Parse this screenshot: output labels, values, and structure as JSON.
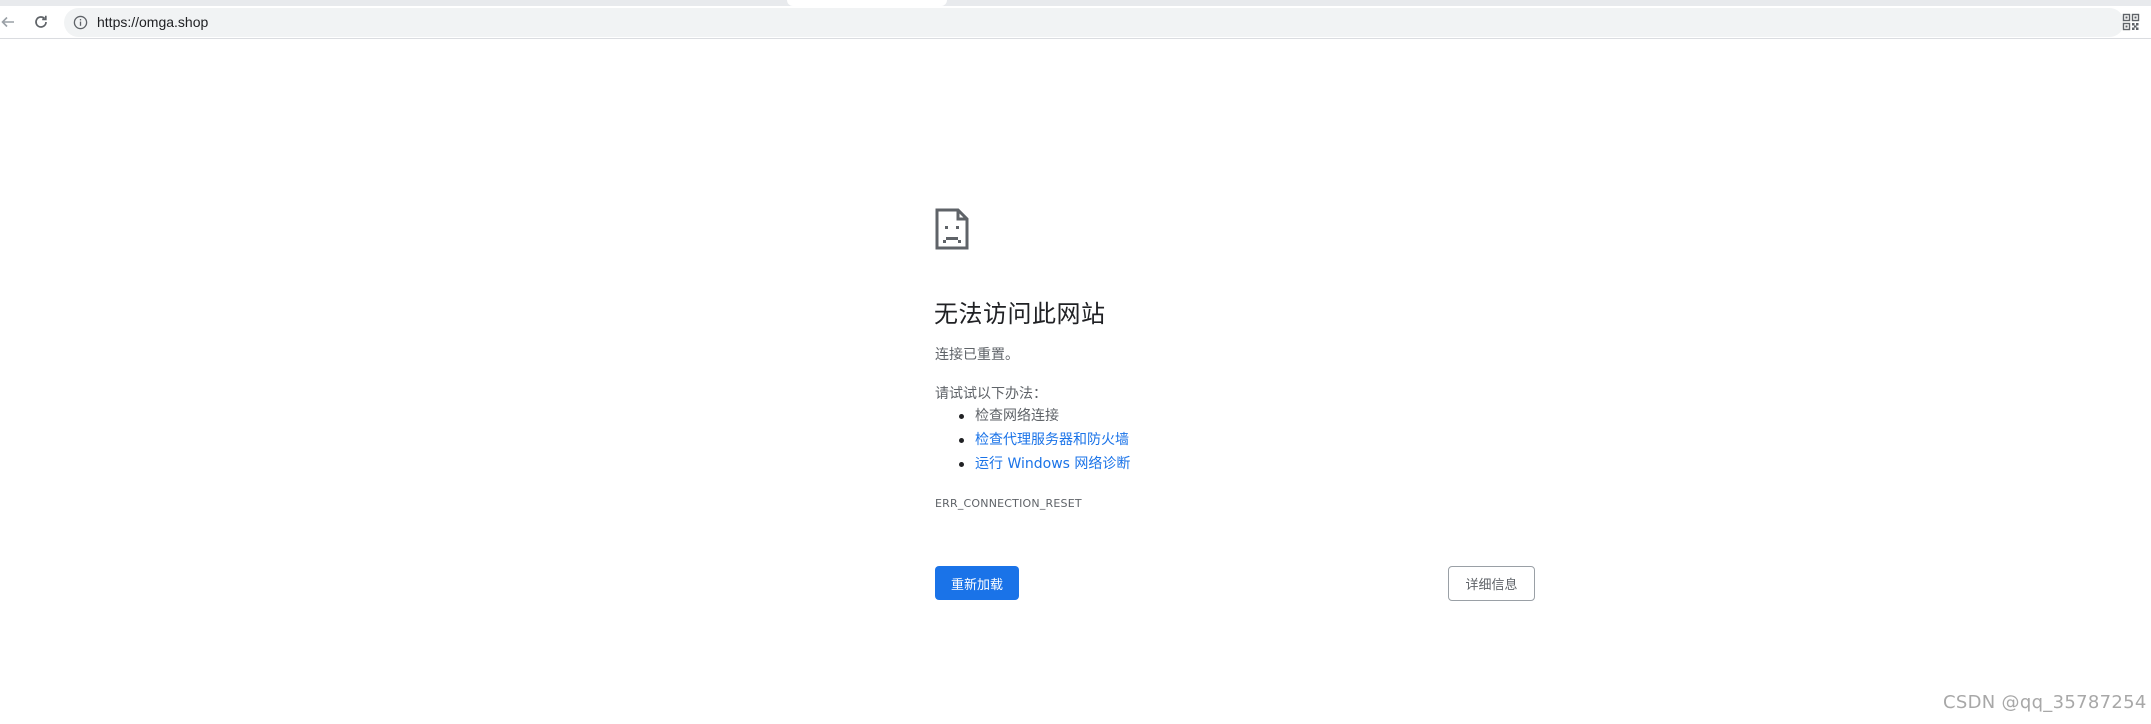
{
  "browser": {
    "url": "https://omga.shop"
  },
  "error_page": {
    "heading": "无法访问此网站",
    "summary": "连接已重置。",
    "suggestions_heading": "请试试以下办法：",
    "suggestions": [
      {
        "label": "检查网络连接",
        "is_link": false
      },
      {
        "label": "检查代理服务器和防火墙",
        "is_link": true
      },
      {
        "label": "运行 Windows 网络诊断",
        "is_link": true
      }
    ],
    "error_code": "ERR_CONNECTION_RESET",
    "reload_label": "重新加载",
    "details_label": "详细信息"
  },
  "watermark": "CSDN @qq_35787254",
  "colors": {
    "primary_blue": "#1a73e8",
    "text_dark": "#202124",
    "text_secondary": "#5f6368",
    "omnibox_bg": "#f1f3f4"
  },
  "icons": {
    "back": "arrow-left-icon",
    "reload": "reload-icon",
    "site_info": "info-icon",
    "qr": "qr-code-icon",
    "error": "sad-page-icon"
  }
}
